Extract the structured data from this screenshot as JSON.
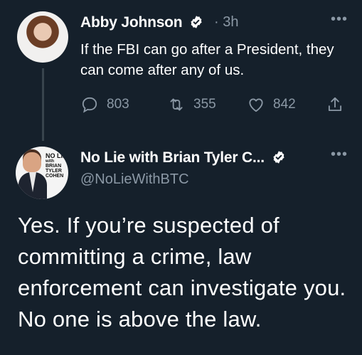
{
  "tweet1": {
    "author_name": "Abby Johnson",
    "time": "· 3h",
    "text": "If the FBI can go after a President, they can come after any of us.",
    "replies": "803",
    "retweets": "355",
    "likes": "842",
    "more": "•••"
  },
  "tweet2": {
    "author_name": "No Lie with Brian Tyler C...",
    "handle": "@NoLieWithBTC",
    "text": "Yes. If you’re suspected of committing a crime, law enforcement can investigate you. No one is above the law.",
    "more": "•••",
    "avatar_logo_lines": [
      "NO LIE",
      "with",
      "BRIAN",
      "TYLER",
      "COHEN"
    ]
  },
  "colors": {
    "background": "#15202b",
    "muted": "#8b98a5",
    "verified": "#ffffff"
  },
  "icons": [
    "verified-badge-icon",
    "reply-icon",
    "retweet-icon",
    "like-icon",
    "share-icon",
    "more-icon"
  ]
}
